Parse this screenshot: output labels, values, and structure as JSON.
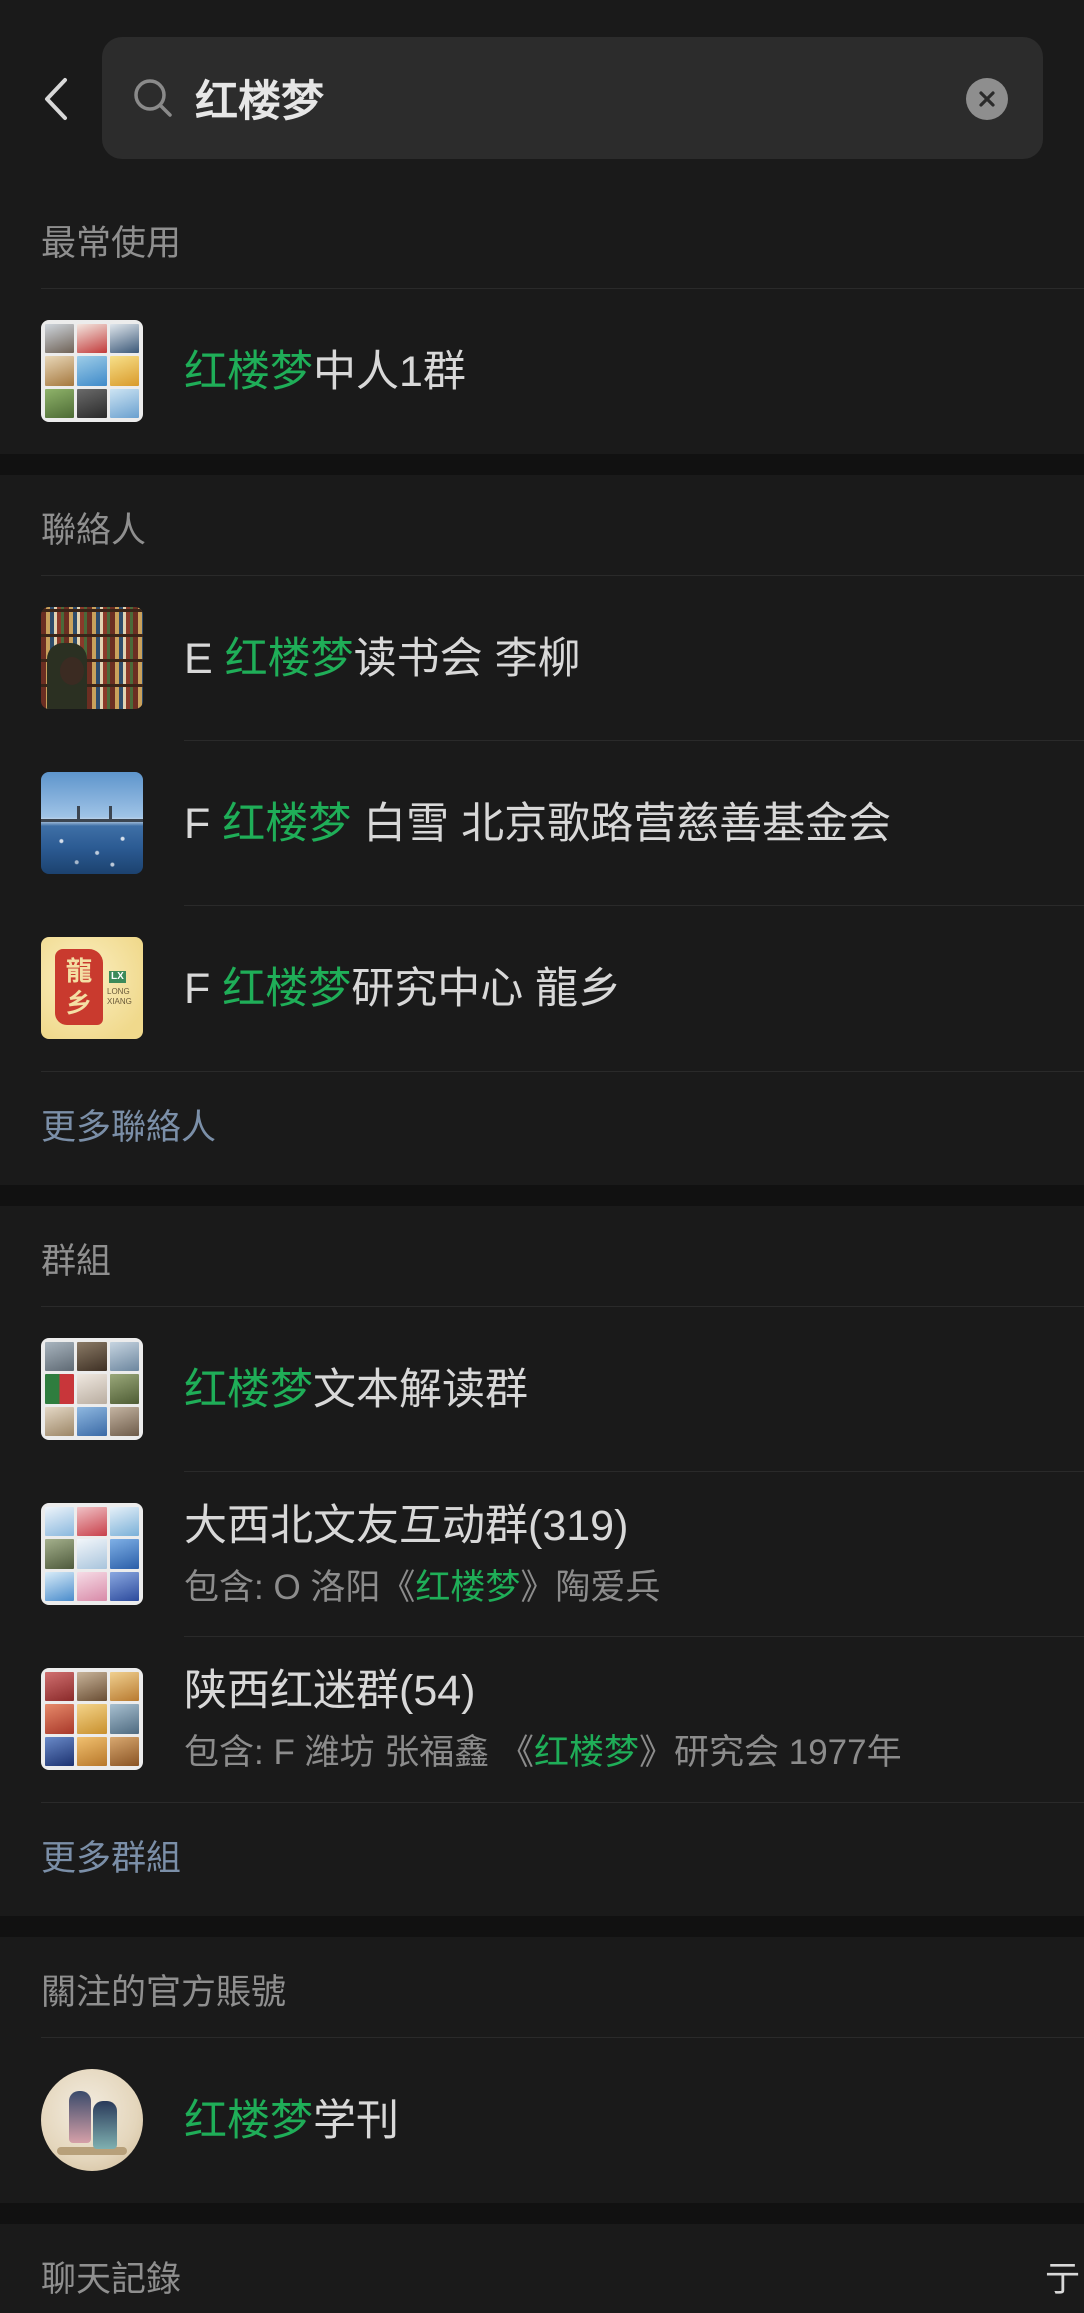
{
  "search": {
    "query": "红楼梦",
    "back_icon": "chevron-left-icon",
    "search_icon": "search-icon",
    "clear_icon": "clear-icon"
  },
  "colors": {
    "background": "#1a1a1a",
    "section_gap": "#111111",
    "text": "#d8d8d8",
    "label": "#8f8f8f",
    "match_highlight": "#1fae58",
    "more_link": "#7b8fa8",
    "search_box": "#2c2c2c"
  },
  "frequent": {
    "label": "最常使用",
    "items": [
      {
        "title": [
          {
            "text": "红楼梦",
            "match": true
          },
          {
            "text": "中人1群",
            "match": false
          }
        ]
      }
    ]
  },
  "contacts": {
    "label": "聯絡人",
    "items": [
      {
        "title": [
          {
            "text": "E ",
            "match": false
          },
          {
            "text": "红楼梦",
            "match": true
          },
          {
            "text": "读书会 李柳",
            "match": false
          }
        ]
      },
      {
        "title": [
          {
            "text": "F ",
            "match": false
          },
          {
            "text": "红楼梦",
            "match": true
          },
          {
            "text": " 白雪 北京歌路营慈善基金会",
            "match": false
          }
        ]
      },
      {
        "title": [
          {
            "text": "F ",
            "match": false
          },
          {
            "text": "红楼梦",
            "match": true
          },
          {
            "text": "研究中心 龍乡",
            "match": false
          }
        ],
        "avatar_logo": {
          "seal": [
            "龍",
            "乡"
          ],
          "mark": "LX",
          "caption": [
            "LONG",
            "XIANG"
          ]
        }
      }
    ],
    "more": "更多聯絡人"
  },
  "groups": {
    "label": "群組",
    "items": [
      {
        "title": [
          {
            "text": "红楼梦",
            "match": true
          },
          {
            "text": "文本解读群",
            "match": false
          }
        ]
      },
      {
        "title": [
          {
            "text": "大西北文友互动群(319)",
            "match": false
          }
        ],
        "subtitle": [
          {
            "text": "包含: O 洛阳《",
            "match": false
          },
          {
            "text": "红楼梦",
            "match": true
          },
          {
            "text": "》陶爱兵",
            "match": false
          }
        ]
      },
      {
        "title": [
          {
            "text": "陕西红迷群(54)",
            "match": false
          }
        ],
        "subtitle": [
          {
            "text": "包含: F 潍坊 张福鑫 《",
            "match": false
          },
          {
            "text": "红楼梦",
            "match": true
          },
          {
            "text": "》研究会 1977年",
            "match": false
          }
        ]
      }
    ],
    "more": "更多群組"
  },
  "official_accounts": {
    "label": "關注的官方賬號",
    "items": [
      {
        "title": [
          {
            "text": "红楼梦",
            "match": true
          },
          {
            "text": "学刊",
            "match": false
          }
        ]
      }
    ]
  },
  "chat_history": {
    "label": "聊天記錄",
    "partial_text": "亍"
  }
}
